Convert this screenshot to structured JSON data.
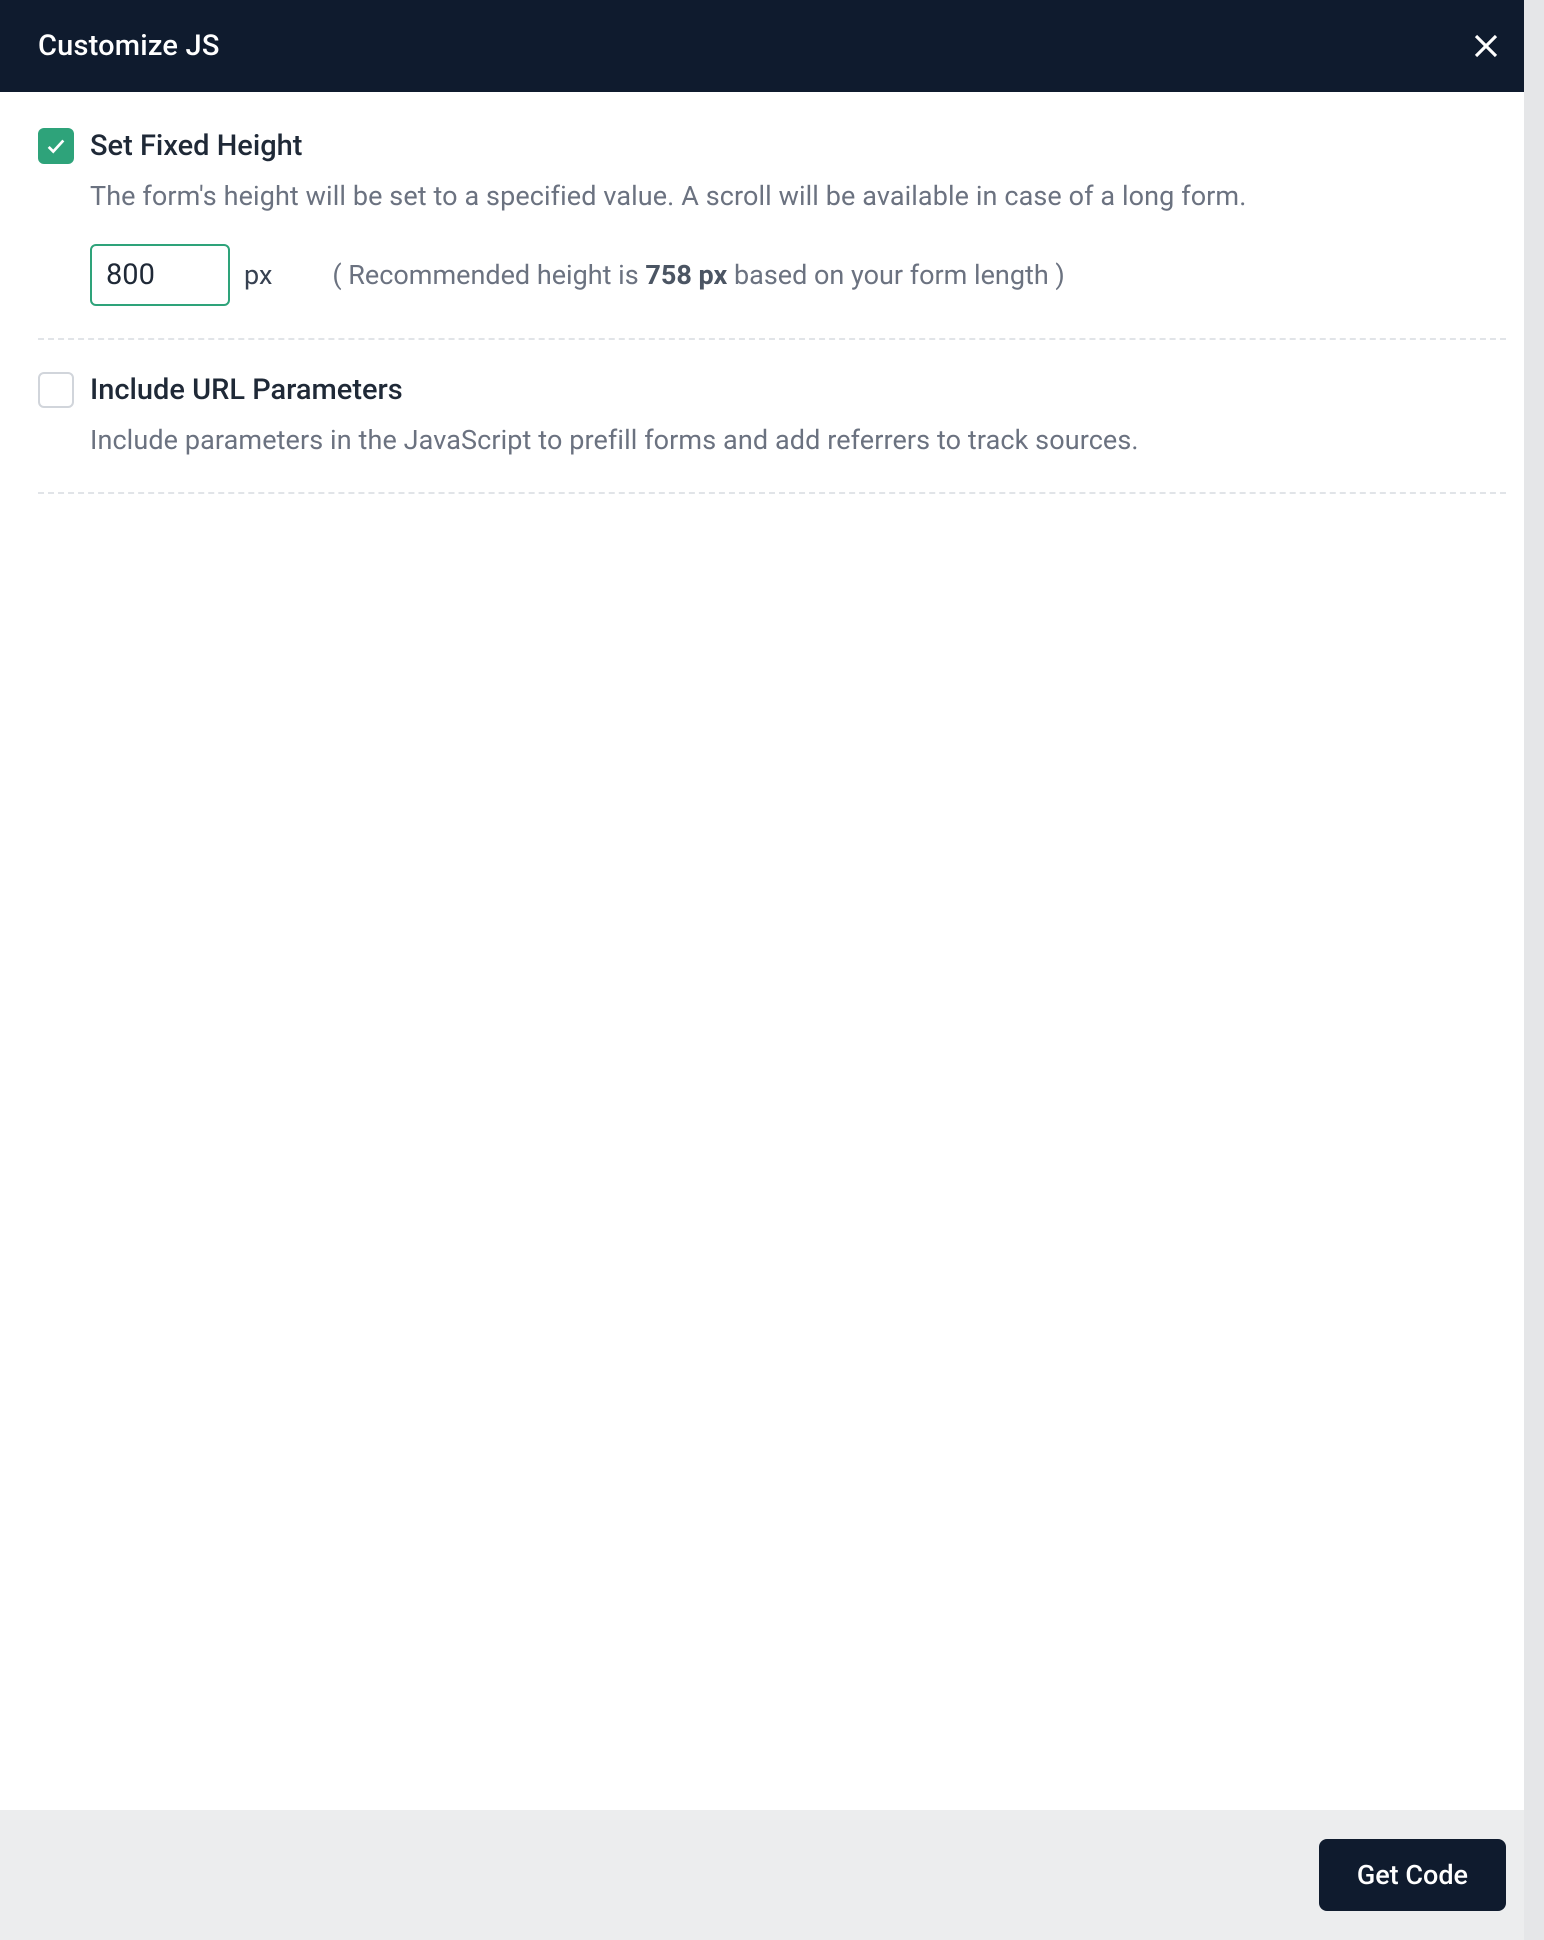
{
  "header": {
    "title": "Customize JS"
  },
  "options": {
    "fixedHeight": {
      "checked": true,
      "title": "Set Fixed Height",
      "description": "The form's height will be set to a specified value. A scroll will be available in case of a long form.",
      "inputValue": "800",
      "unit": "px",
      "recommendationPrefix": "( Recommended height is ",
      "recommendationValue": "758 px",
      "recommendationSuffix": " based on your form length )"
    },
    "urlParams": {
      "checked": false,
      "title": "Include URL Parameters",
      "description": "Include parameters in the JavaScript to prefill forms and add referrers to track sources."
    }
  },
  "footer": {
    "buttonLabel": "Get Code"
  }
}
